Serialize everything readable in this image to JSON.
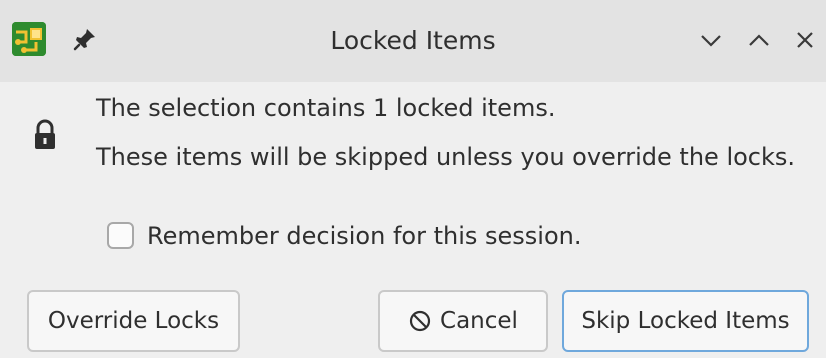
{
  "window": {
    "title": "Locked Items",
    "controls": [
      "minimize",
      "maximize",
      "close"
    ]
  },
  "icons": {
    "app": "pcb-app-icon",
    "pin": "pin-icon",
    "lock": "lock-icon",
    "cancel": "cancel-circle-slash-icon"
  },
  "message": {
    "line1": "The selection contains 1 locked items.",
    "line2": "These items will be skipped unless you override the locks."
  },
  "remember": {
    "label": "Remember decision for this session.",
    "checked": false
  },
  "buttons": {
    "override": "Override Locks",
    "cancel": "Cancel",
    "skip": "Skip Locked Items"
  },
  "colors": {
    "titlebar": "#e3e3e3",
    "background": "#efefef",
    "default_button_border": "#6fa8dc"
  }
}
